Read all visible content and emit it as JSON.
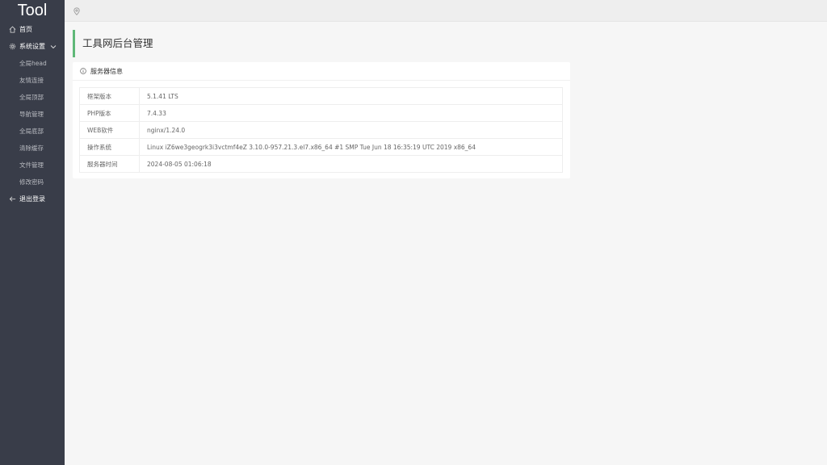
{
  "app": {
    "logo": "Tool"
  },
  "sidebar": {
    "home": {
      "label": "首页",
      "icon": "home-icon"
    },
    "settings": {
      "label": "系统设置",
      "icon": "gear-icon",
      "items": [
        {
          "label": "全局head"
        },
        {
          "label": "友情连接"
        },
        {
          "label": "全局顶部"
        },
        {
          "label": "导航管理"
        },
        {
          "label": "全局底部"
        },
        {
          "label": "清除缓存"
        },
        {
          "label": "文件管理"
        },
        {
          "label": "修改密码"
        }
      ]
    },
    "logout": {
      "label": "退出登录",
      "icon": "arrow-left-icon"
    }
  },
  "topbar": {
    "icon": "location-pin-icon"
  },
  "main": {
    "title": "工具网后台管理",
    "card": {
      "title": "服务器信息",
      "icon": "info-icon",
      "rows": [
        {
          "label": "框架版本",
          "value": "5.1.41 LTS"
        },
        {
          "label": "PHP版本",
          "value": "7.4.33"
        },
        {
          "label": "WEB软件",
          "value": "nginx/1.24.0"
        },
        {
          "label": "操作系统",
          "value": "Linux iZ6we3geogrk3i3vctmf4eZ 3.10.0-957.21.3.el7.x86_64 #1 SMP Tue Jun 18 16:35:19 UTC 2019 x86_64"
        },
        {
          "label": "服务器时间",
          "value": "2024-08-05 01:06:18"
        }
      ]
    }
  },
  "colors": {
    "sidebar": "#393d49",
    "accent": "#5fb878",
    "background": "#f6f6f6"
  }
}
